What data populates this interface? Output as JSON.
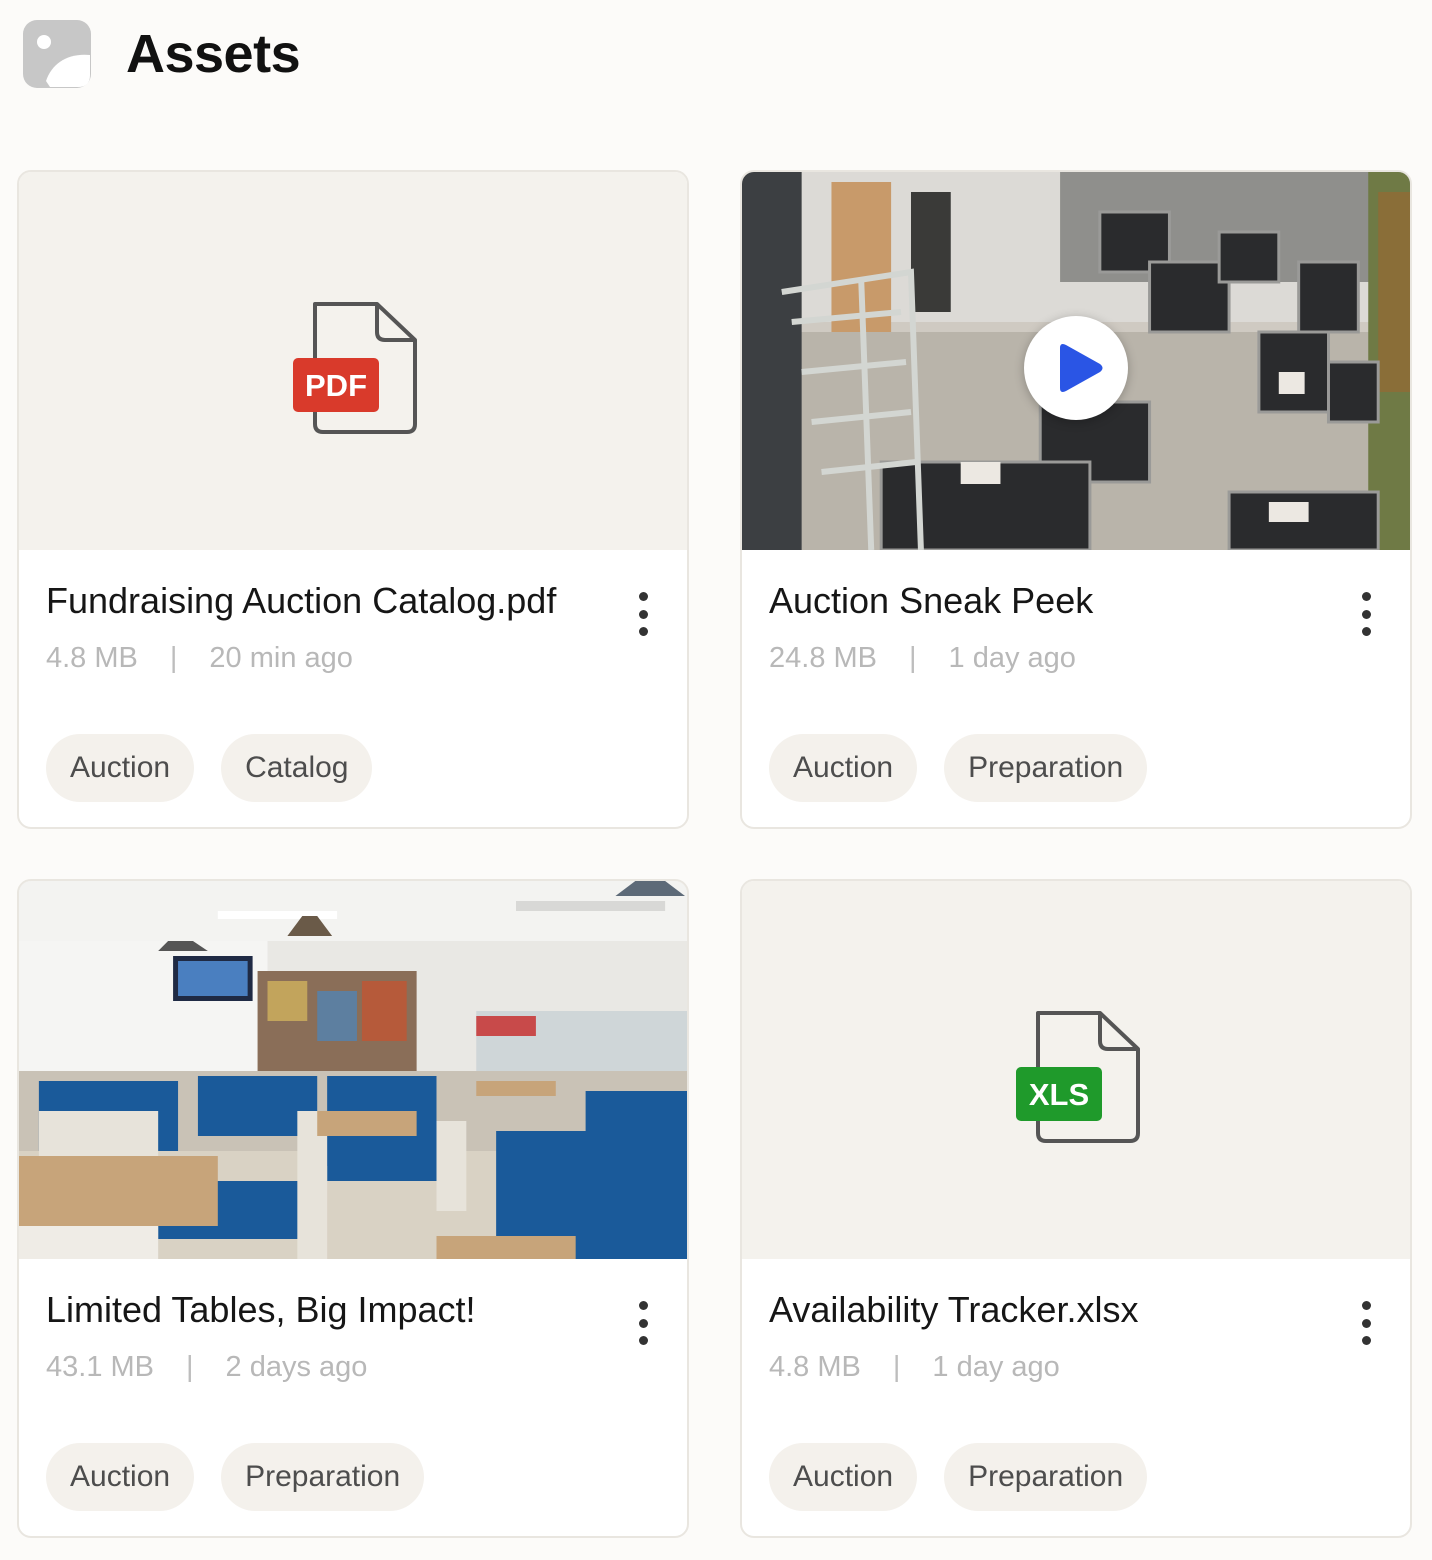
{
  "header": {
    "title": "Assets",
    "icon": "image-icon"
  },
  "assets": [
    {
      "title": "Fundraising Auction Catalog.pdf",
      "size": "4.8 MB",
      "separator": "|",
      "time": "20 min ago",
      "tags": [
        "Auction",
        "Catalog"
      ],
      "thumbnail": "pdf-file-icon",
      "badge": "PDF"
    },
    {
      "title": "Auction Sneak Peek",
      "size": "24.8 MB",
      "separator": "|",
      "time": "1 day ago",
      "tags": [
        "Auction",
        "Preparation"
      ],
      "thumbnail": "video-thumbnail",
      "overlay_icon": "play-icon"
    },
    {
      "title": "Limited Tables, Big Impact!",
      "size": "43.1 MB",
      "separator": "|",
      "time": "2 days ago",
      "tags": [
        "Auction",
        "Preparation"
      ],
      "thumbnail": "photo-thumbnail"
    },
    {
      "title": "Availability Tracker.xlsx",
      "size": "4.8 MB",
      "separator": "|",
      "time": "1 day ago",
      "tags": [
        "Auction",
        "Preparation"
      ],
      "thumbnail": "xls-file-icon",
      "badge": "XLS"
    }
  ],
  "colors": {
    "pdf_badge": "#d93a2b",
    "xls_badge": "#1f9a2b",
    "play": "#2a55e5",
    "tag_bg": "#f4f1ec",
    "thumb_bg": "#f4f2ed",
    "meta_text": "#b8b8b8"
  }
}
